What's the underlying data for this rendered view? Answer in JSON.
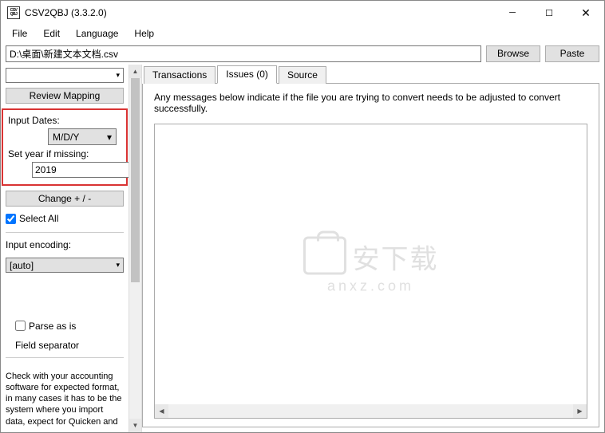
{
  "window": {
    "title": "CSV2QBJ (3.3.2.0)",
    "icon_line1": "CSV",
    "icon_line2": "QBJ"
  },
  "menu": {
    "file": "File",
    "edit": "Edit",
    "language": "Language",
    "help": "Help"
  },
  "path": {
    "value": "D:\\桌面\\新建文本文档.csv",
    "browse": "Browse",
    "paste": "Paste"
  },
  "sidebar": {
    "top_select": "",
    "review_mapping": "Review Mapping",
    "input_dates_label": "Input Dates:",
    "date_format": "M/D/Y",
    "set_year_label": "Set year if missing:",
    "year": "2019",
    "change_sign": "Change + / -",
    "select_all": "Select All",
    "input_encoding_label": "Input encoding:",
    "encoding": "[auto]",
    "parse_as_is": "Parse as is",
    "field_separator": "Field separator",
    "bottom_note": "Check with your accounting software for expected format, in many cases it has to be the system where you import data, expect for Quicken and"
  },
  "tabs": {
    "transactions": "Transactions",
    "issues": "Issues (0)",
    "source": "Source"
  },
  "content": {
    "message": "Any messages below indicate if the file you are trying to convert needs to be adjusted to convert successfully."
  },
  "watermark": {
    "main": "安下载",
    "sub": "anxz.com"
  }
}
